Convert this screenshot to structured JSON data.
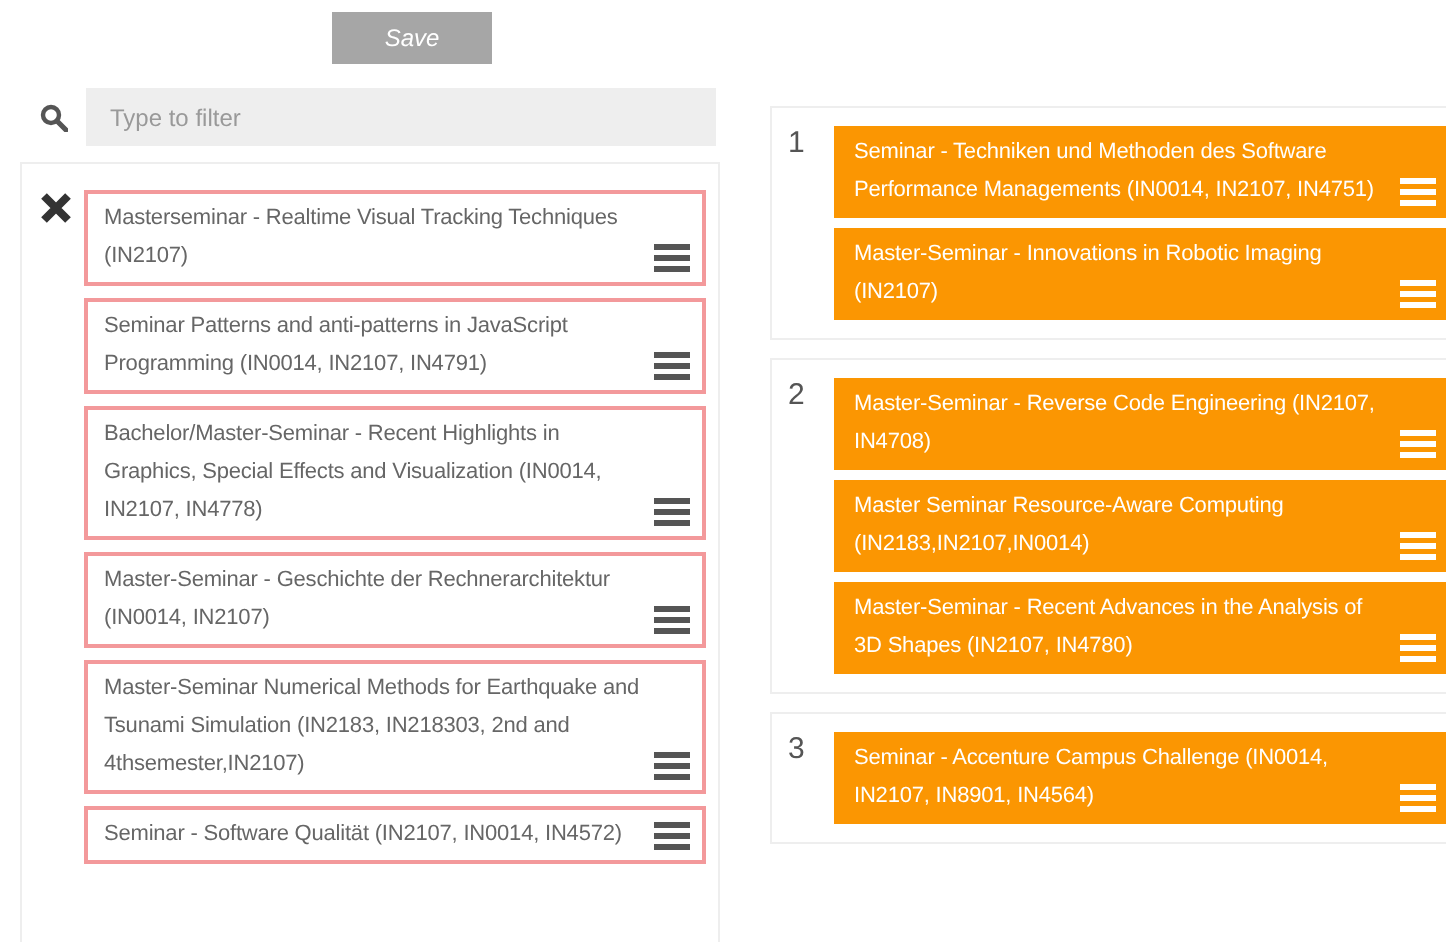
{
  "save_button": {
    "label": "Save"
  },
  "filter": {
    "placeholder": "Type to filter"
  },
  "available": [
    {
      "title": "Masterseminar - Realtime Visual Tracking Techniques (IN2107)"
    },
    {
      "title": "Seminar Patterns and anti-patterns in JavaScript Programming (IN0014, IN2107, IN4791)"
    },
    {
      "title": "Bachelor/Master-Seminar - Recent Highlights in Graphics, Special Effects and Visualization (IN0014, IN2107, IN4778)"
    },
    {
      "title": "Master-Seminar - Geschichte der Rechnerarchitektur (IN0014, IN2107)"
    },
    {
      "title": "Master-Seminar Numerical Methods for Earthquake and Tsunami Simulation (IN2183, IN218303, 2nd and 4thsemester,IN2107)"
    },
    {
      "title": "Seminar - Software Qualität (IN2107, IN0014, IN4572)"
    }
  ],
  "priorities": [
    {
      "rank": "1",
      "items": [
        {
          "title": "Seminar - Techniken und Methoden des Software Performance Managements (IN0014, IN2107, IN4751)"
        },
        {
          "title": "Master-Seminar - Innovations in Robotic Imaging (IN2107)"
        }
      ]
    },
    {
      "rank": "2",
      "items": [
        {
          "title": "Master-Seminar - Reverse Code Engineering (IN2107, IN4708)"
        },
        {
          "title": "Master Seminar Resource-Aware Computing (IN2183,IN2107,IN0014)"
        },
        {
          "title": "Master-Seminar - Recent Advances in the Analysis of 3D Shapes (IN2107, IN4780)"
        }
      ]
    },
    {
      "rank": "3",
      "items": [
        {
          "title": "Seminar - Accenture Campus Challenge (IN0014, IN2107, IN8901, IN4564)"
        }
      ]
    }
  ]
}
